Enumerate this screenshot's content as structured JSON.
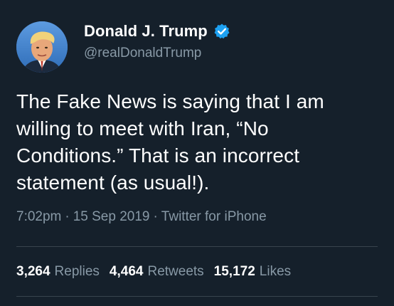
{
  "tweet": {
    "display_name": "Donald J. Trump",
    "handle": "@realDonaldTrump",
    "verified_icon": "verified-badge-icon",
    "avatar_icon": "avatar-photo",
    "text": "The Fake News is saying that I am willing to meet with Iran, “No Conditions.” That is an incorrect statement (as usual!).",
    "time": "7:02pm",
    "date": "15 Sep 2019",
    "source": "Twitter for iPhone",
    "separator": "·"
  },
  "stats": {
    "replies_count": "3,264",
    "replies_label": "Replies",
    "retweets_count": "4,464",
    "retweets_label": "Retweets",
    "likes_count": "15,172",
    "likes_label": "Likes"
  },
  "colors": {
    "background": "#15202b",
    "text_primary": "#ffffff",
    "text_secondary": "#8899a6",
    "divider": "#38444d",
    "verified": "#1da1f2"
  }
}
